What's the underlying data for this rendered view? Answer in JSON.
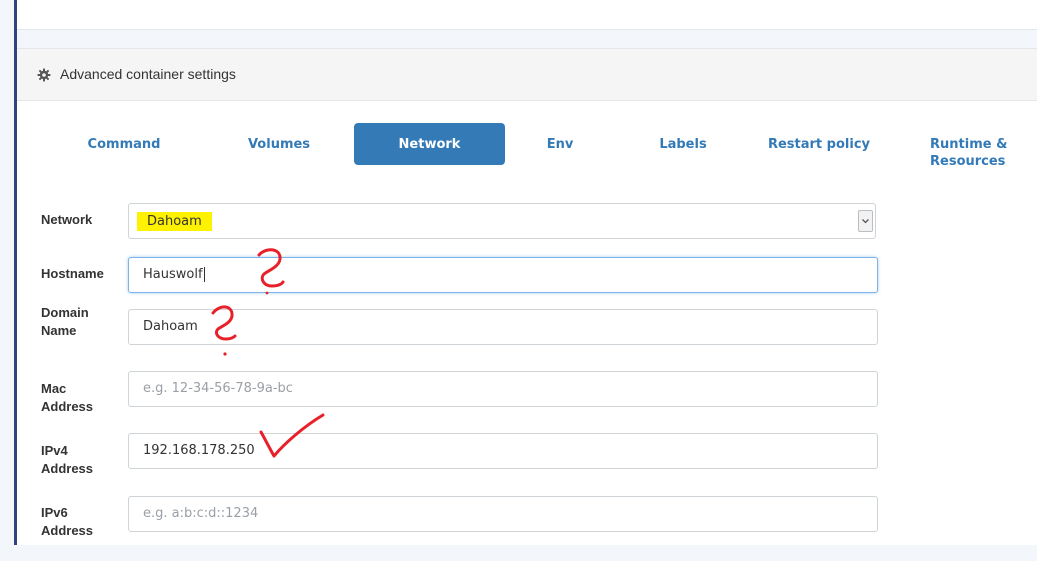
{
  "panel": {
    "title": "Advanced container settings",
    "icon": "gear-icon"
  },
  "tabs": [
    {
      "label": "Command",
      "active": false
    },
    {
      "label": "Volumes",
      "active": false
    },
    {
      "label": "Network",
      "active": true
    },
    {
      "label": "Env",
      "active": false
    },
    {
      "label": "Labels",
      "active": false
    },
    {
      "label": "Restart policy",
      "active": false
    },
    {
      "label_line1": "Runtime &",
      "label_line2": "Resources",
      "active": false
    }
  ],
  "form": {
    "network": {
      "label": "Network",
      "value": "Dahoam"
    },
    "hostname": {
      "label": "Hostname",
      "value": "Hauswolf"
    },
    "domain": {
      "label_line1": "Domain",
      "label_line2": "Name",
      "value": "Dahoam"
    },
    "mac": {
      "label_line1": "Mac",
      "label_line2": "Address",
      "placeholder": "e.g. 12-34-56-78-9a-bc"
    },
    "ipv4": {
      "label_line1": "IPv4",
      "label_line2": "Address",
      "value": "192.168.178.250"
    },
    "ipv6": {
      "label_line1": "IPv6",
      "label_line2": "Address",
      "placeholder": "e.g. a:b:c:d::1234"
    }
  },
  "colors": {
    "accent": "#337ab7",
    "highlight": "#fff200",
    "annotation": "#e8202a",
    "rail": "#2f4380"
  }
}
